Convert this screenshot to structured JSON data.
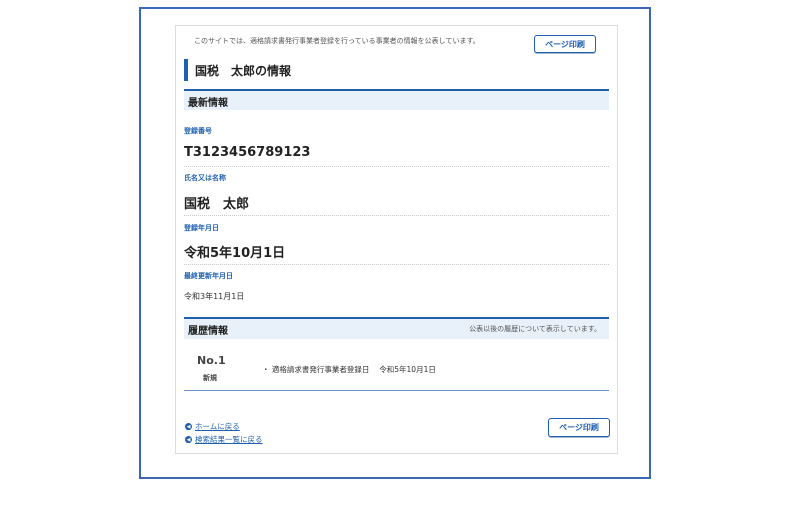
{
  "notice": "このサイトでは、適格請求書発行事業者登録を行っている事業者の情報を公表しています。",
  "print_button": "ページ印刷",
  "page_title": "国税　太郎の情報",
  "latest": {
    "heading": "最新情報",
    "fields": [
      {
        "label": "登録番号",
        "value": "T3123456789123"
      },
      {
        "label": "氏名又は名称",
        "value": "国税　太郎"
      },
      {
        "label": "登録年月日",
        "value": "令和5年10月1日"
      },
      {
        "label": "最終更新年月日",
        "value": "令和3年11月1日"
      }
    ]
  },
  "history": {
    "heading": "履歴情報",
    "note": "公表以後の履歴について表示しています。",
    "entries": [
      {
        "no": "No.1",
        "type": "新規",
        "detail": "・ 適格請求書発行事業者登録日　 令和5年10月1日"
      }
    ]
  },
  "links": {
    "home": "ホームに戻る",
    "back": "検索結果一覧に戻る"
  },
  "colors": {
    "accent": "#1f5fb0",
    "section_bg": "#e8f1fa",
    "frame": "#3a67b8"
  }
}
